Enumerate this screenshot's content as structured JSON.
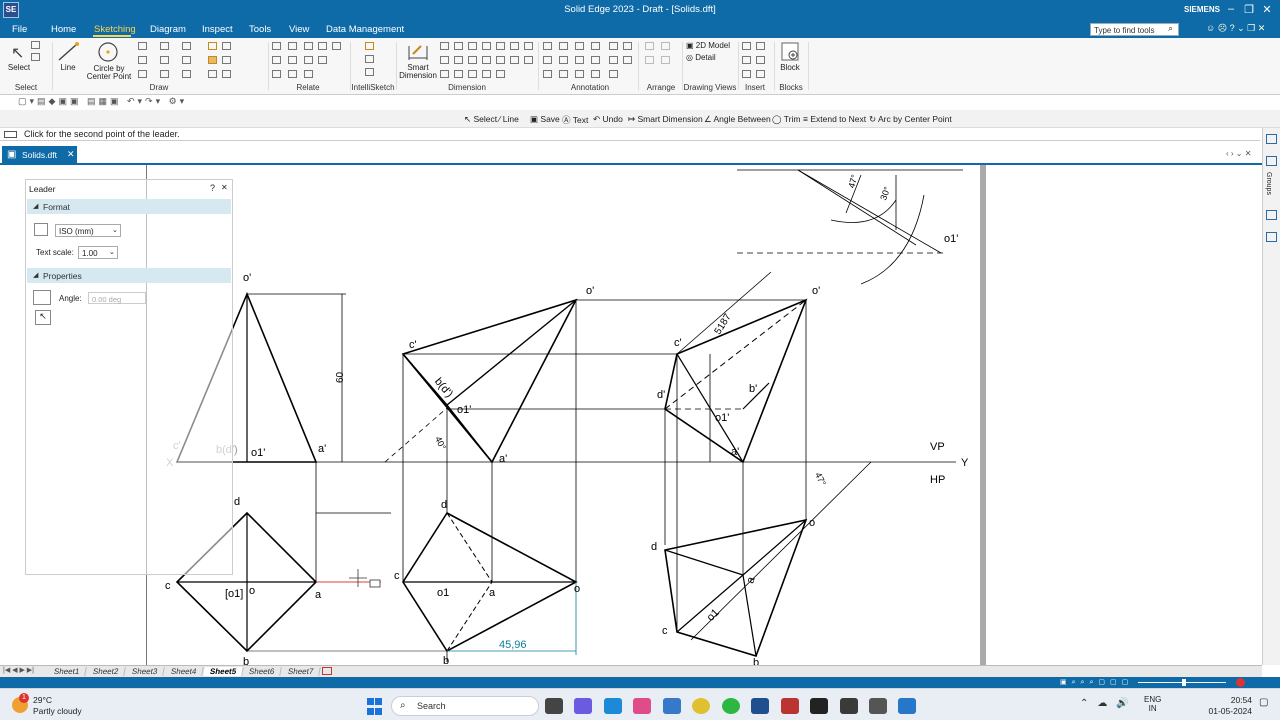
{
  "app": {
    "title": "Solid Edge 2023 - Draft - [Solids.dft]",
    "logo": "SE",
    "brand": "SIEMENS",
    "find_placeholder": "Type to find tools"
  },
  "menu": [
    "File",
    "Home",
    "Sketching",
    "Diagram",
    "Inspect",
    "Tools",
    "View",
    "Data Management"
  ],
  "menu_active": "Sketching",
  "ribbon": {
    "groups": [
      "Select",
      "Draw",
      "Relate",
      "IntelliSketch",
      "Dimension",
      "Annotation",
      "Arrange",
      "Drawing Views",
      "Insert",
      "Blocks"
    ],
    "buttons": {
      "select": "Select",
      "line": "Line",
      "circle": "Circle by Center Point",
      "smart_dim": "Smart Dimension",
      "model_2d": "2D Model",
      "detail": "Detail",
      "block": "Block"
    }
  },
  "command_bar": [
    "Select",
    "Line",
    "Save",
    "Text",
    "Undo",
    "Smart Dimension",
    "Angle Between",
    "Trim",
    "Extend to Next",
    "Arc by Center Point"
  ],
  "prompt": "Click for the second point of the leader.",
  "doc_tab": "Solids.dft",
  "leader_panel": {
    "title": "Leader",
    "help": "?",
    "close": "✕",
    "format_header": "Format",
    "standard": "ISO (mm)",
    "text_scale_label": "Text scale:",
    "text_scale_value": "1.00",
    "properties_header": "Properties",
    "angle_label": "Angle:",
    "angle_value": "0.00 deg"
  },
  "drawing_labels": {
    "vp": "VP",
    "hp": "HP",
    "x": "X",
    "y": "Y",
    "dim_height": "60",
    "dim_length": "45,96",
    "dim_edge": "5187",
    "ang_40": "40°",
    "ang_47a": "47°",
    "ang_47b": "47°",
    "ang_30": "30°",
    "v1": {
      "o": "o'",
      "ol": "o1'",
      "a": "a'",
      "b": "b(d')",
      "c": "c'"
    },
    "p1": {
      "d": "d",
      "c": "c",
      "o": "o",
      "o1": "[o1]",
      "a": "a",
      "b": "b"
    },
    "v2": {
      "o": "o'",
      "c": "c'",
      "bd": "b(d')",
      "o1": "o1'",
      "a": "a'"
    },
    "p2": {
      "d": "d",
      "c": "c",
      "o1": "o1",
      "a": "a",
      "o": "o",
      "b": "b"
    },
    "v3": {
      "o": "o'",
      "c": "c'",
      "d": "d'",
      "b": "b'",
      "o1": "o1'",
      "a": "a'"
    },
    "p3": {
      "d": "d",
      "o": "o",
      "a": "a",
      "o1": "o1",
      "c": "c",
      "b": "b"
    },
    "aux": {
      "o1": "o1'"
    }
  },
  "sheets": [
    "Sheet1",
    "Sheet2",
    "Sheet3",
    "Sheet4",
    "Sheet5",
    "Sheet6",
    "Sheet7"
  ],
  "active_sheet": "Sheet5",
  "taskbar": {
    "temp": "29°C",
    "weather": "Partly cloudy",
    "search": "Search",
    "lang1": "ENG",
    "lang2": "IN",
    "time": "20:54",
    "date": "01-05-2024",
    "badge": "1"
  },
  "side_tabs": [
    "Groups"
  ]
}
